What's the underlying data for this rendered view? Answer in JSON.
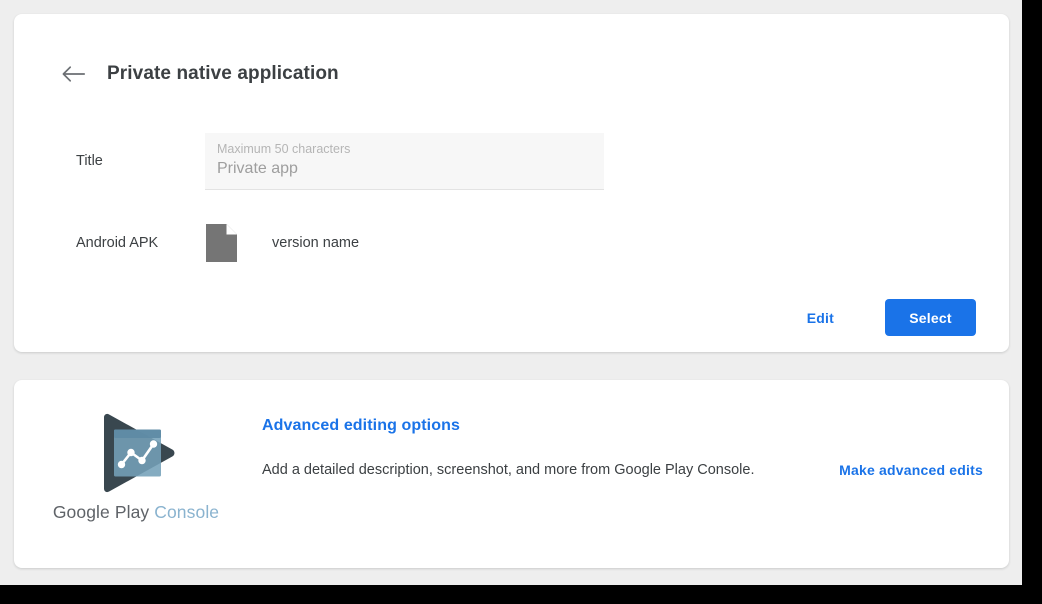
{
  "window": {
    "background_color": "#eeeeee",
    "card_color": "#ffffff",
    "accent_color": "#1a73e8"
  },
  "header": {
    "back_icon": "arrow-left-icon",
    "title": "Private native application"
  },
  "app_details": {
    "title_row": {
      "label": "Title",
      "field_hint": "Maximum 50 characters",
      "field_value": "Private app",
      "field_placeholder": "Private app"
    },
    "apk_row": {
      "label": "Android APK",
      "file_icon": "file-document-icon",
      "version_name": "version name"
    },
    "actions": {
      "edit_label": "Edit",
      "select_label": "Select"
    }
  },
  "advanced": {
    "logo": {
      "mark_icon": "google-play-console-logo",
      "word_primary": "Google Play",
      "word_secondary": "Console"
    },
    "title": "Advanced editing options",
    "description": "Add a detailed description, screenshot, and more from Google Play Console.",
    "link_label": "Make advanced edits"
  }
}
